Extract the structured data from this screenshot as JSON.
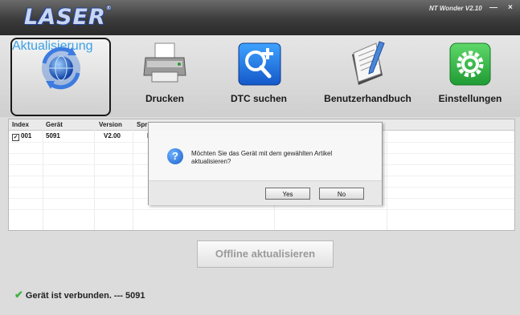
{
  "window": {
    "logo": "LASER",
    "version": "NT Wonder V2.10",
    "minimize": "—",
    "close": "×"
  },
  "toolbar": {
    "items": [
      {
        "label": "Aktualisierung",
        "icon": "globe-refresh-icon"
      },
      {
        "label": "Drucken",
        "icon": "printer-icon"
      },
      {
        "label": "DTC suchen",
        "icon": "magnifier-plus-icon"
      },
      {
        "label": "Benutzerhandbuch",
        "icon": "manual-book-icon"
      },
      {
        "label": "Einstellungen",
        "icon": "gear-icon"
      }
    ],
    "active_index": 0
  },
  "table": {
    "headers": [
      "Index",
      "Gerät",
      "Version",
      "Spr"
    ],
    "rows": [
      {
        "index": "001",
        "device": "5091",
        "version": "V2.00",
        "lang": "D",
        "checked": true
      }
    ]
  },
  "dialog": {
    "message": "Möchten Sie das Gerät mit dem gewählten Artikel aktualisieren?",
    "yes_label": "Yes",
    "no_label": "No"
  },
  "actions": {
    "offline_label": "Offline aktualisieren"
  },
  "status": {
    "text": "Gerät ist verbunden. --- 5091"
  },
  "colors": {
    "active_label": "#3aa1e6",
    "check": "#3fb13f"
  }
}
